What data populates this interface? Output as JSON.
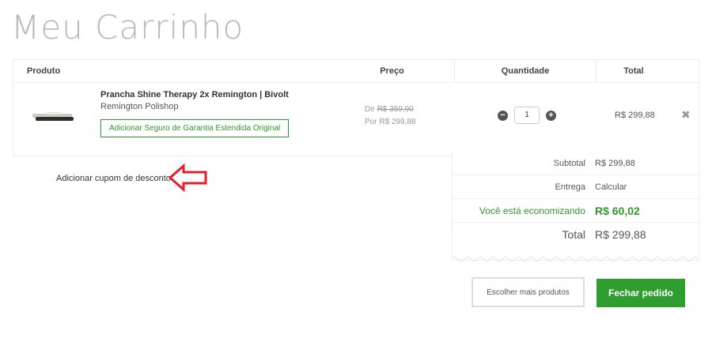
{
  "page_title": "Meu Carrinho",
  "table": {
    "headers": {
      "product": "Produto",
      "price": "Preço",
      "quantity": "Quantidade",
      "total": "Total"
    },
    "items": [
      {
        "name": "Prancha Shine Therapy 2x Remington | Bivolt",
        "brand": "Remington Polishop",
        "warranty_label": "Adicionar Seguro de Garantia Estendida Original",
        "price_from_prefix": "De",
        "price_from": "R$ 359,90",
        "price_to": "Por R$ 299,88",
        "quantity": "1",
        "total": "R$ 299,88"
      }
    ]
  },
  "coupon": {
    "label": "Adicionar cupom de desconto"
  },
  "summary": {
    "subtotal_label": "Subtotal",
    "subtotal_value": "R$ 299,88",
    "shipping_label": "Entrega",
    "shipping_value": "Calcular",
    "savings_label": "Você está economizando",
    "savings_value": "R$ 60,02",
    "total_label": "Total",
    "total_value": "R$ 299,88"
  },
  "actions": {
    "more_products": "Escolher mais produtos",
    "checkout": "Fechar pedido"
  },
  "icons": {
    "minus": "minus-circle-icon",
    "plus": "plus-circle-icon",
    "remove": "close-icon"
  },
  "colors": {
    "accent_green": "#2e9e2e",
    "annotation_red": "#e0202a"
  }
}
